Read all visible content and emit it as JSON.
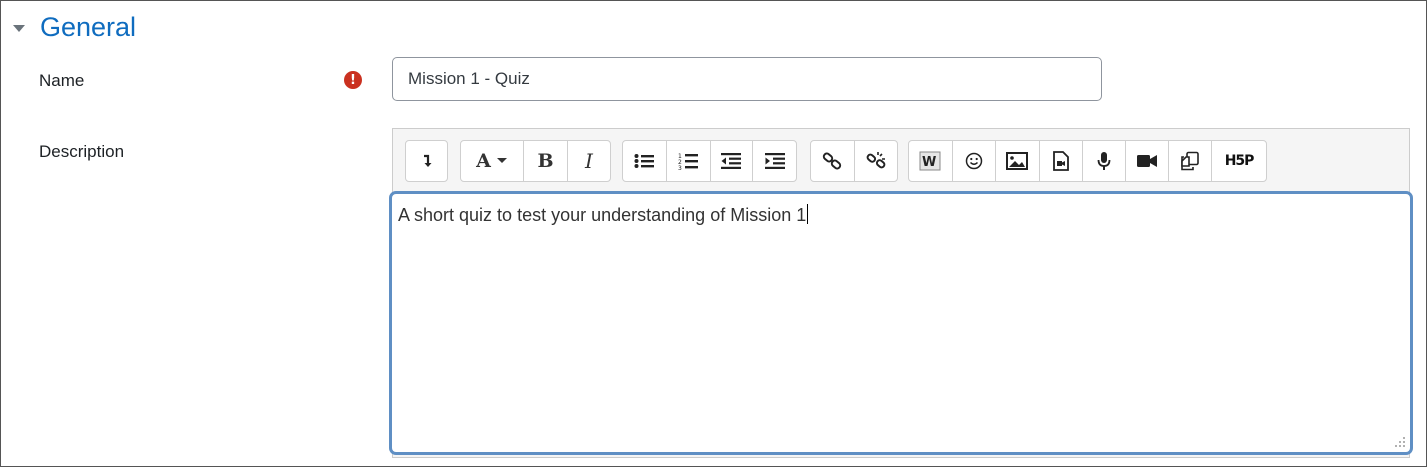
{
  "section": {
    "title": "General",
    "toggle_icon": "caret-down-icon"
  },
  "name_field": {
    "label": "Name",
    "value": "Mission 1 - Quiz",
    "required_icon": "!"
  },
  "description_field": {
    "label": "Description",
    "content": "A short quiz to test your understanding of Mission 1"
  },
  "toolbar": {
    "text_style_label": "A",
    "bold_label": "B",
    "italic_label": "I",
    "h5p_label": "H5P"
  },
  "colors": {
    "accent": "#0f6cbf",
    "required": "#ca3120",
    "focus_border": "#5f8fc4"
  }
}
